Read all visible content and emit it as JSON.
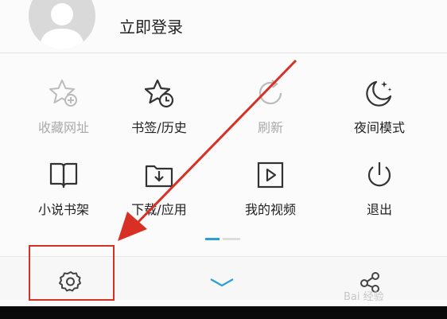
{
  "header": {
    "login_label": "立即登录"
  },
  "menu_items": [
    {
      "label": "收藏网址",
      "icon": "bookmark-add-star-icon",
      "enabled": false
    },
    {
      "label": "书签/历史",
      "icon": "star-clock-icon",
      "enabled": true
    },
    {
      "label": "刷新",
      "icon": "refresh-icon",
      "enabled": false
    },
    {
      "label": "夜间模式",
      "icon": "moon-stars-icon",
      "enabled": true
    },
    {
      "label": "小说书架",
      "icon": "open-book-icon",
      "enabled": true
    },
    {
      "label": "下载/应用",
      "icon": "download-folder-icon",
      "enabled": true
    },
    {
      "label": "我的视频",
      "icon": "video-play-icon",
      "enabled": true
    },
    {
      "label": "退出",
      "icon": "power-icon",
      "enabled": true
    }
  ],
  "pager": {
    "pages": 2,
    "current": 1
  },
  "toolbar": {
    "buttons": [
      "settings-gear-icon",
      "chevron-down-icon",
      "share-icon"
    ]
  },
  "watermark": {
    "text": "Bai 经验"
  },
  "colors": {
    "accent": "#2a9fd6",
    "annotation_red": "#d93025",
    "text": "#222222",
    "disabled_text": "#aaaaaa"
  }
}
